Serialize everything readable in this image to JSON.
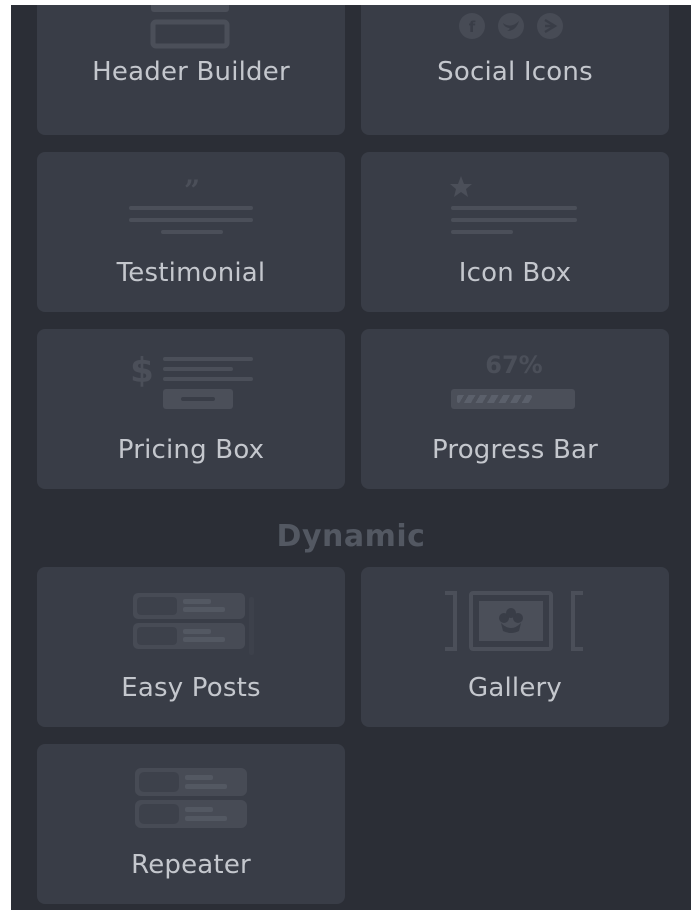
{
  "widgets": {
    "header_builder": {
      "label": "Header Builder"
    },
    "social_icons": {
      "label": "Social Icons"
    },
    "testimonial": {
      "label": "Testimonial"
    },
    "icon_box": {
      "label": "Icon Box"
    },
    "pricing_box": {
      "label": "Pricing Box"
    },
    "progress_bar": {
      "label": "Progress Bar",
      "percent_text": "67%",
      "progress": 0.67
    }
  },
  "dynamic": {
    "heading": "Dynamic",
    "easy_posts": {
      "label": "Easy Posts"
    },
    "gallery": {
      "label": "Gallery"
    },
    "repeater": {
      "label": "Repeater"
    }
  },
  "icons": {
    "header_builder": "header-builder-icon",
    "social_icons": "social-icons-icon",
    "testimonial": "quote-lines-icon",
    "icon_box": "star-lines-icon",
    "pricing_box": "dollar-lines-icon",
    "progress_bar": "progress-bar-icon",
    "easy_posts": "posts-list-icon",
    "gallery": "gallery-flower-icon",
    "repeater": "repeater-list-icon"
  },
  "colors": {
    "panel_background": "#2b2e36",
    "tile_background": "#393d47",
    "label_text": "#c4c7cd",
    "icon_fill": "#4b4f59",
    "heading_text": "#535862"
  }
}
